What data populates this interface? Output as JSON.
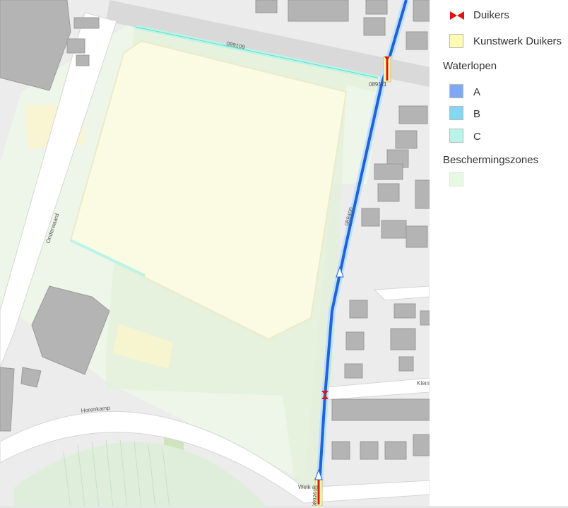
{
  "map": {
    "road_labels": {
      "horenkamp": "Horenkamp",
      "onderwaard": "Onderwaard",
      "kleine": "Klein",
      "welkam": "Welk    am"
    },
    "watercourse_labels": {
      "w089109": "089109",
      "w089111": "089111",
      "w089400": "089400",
      "w089261": "089261"
    }
  },
  "legend": {
    "duikers": {
      "label": "Duikers",
      "icon": "bowtie-icon",
      "color": "#e0140f"
    },
    "kunstwerk": {
      "label": "Kunstwerk Duikers",
      "color": "#fffbb3"
    },
    "waterlopen": {
      "heading": "Waterlopen",
      "items": [
        {
          "label": "A",
          "color": "#7ea8ef"
        },
        {
          "label": "B",
          "color": "#85d6f3"
        },
        {
          "label": "C",
          "color": "#b8f5e8"
        }
      ]
    },
    "beschermingszones": {
      "heading": "Beschermingszones",
      "color": "#e8f9e3"
    }
  }
}
